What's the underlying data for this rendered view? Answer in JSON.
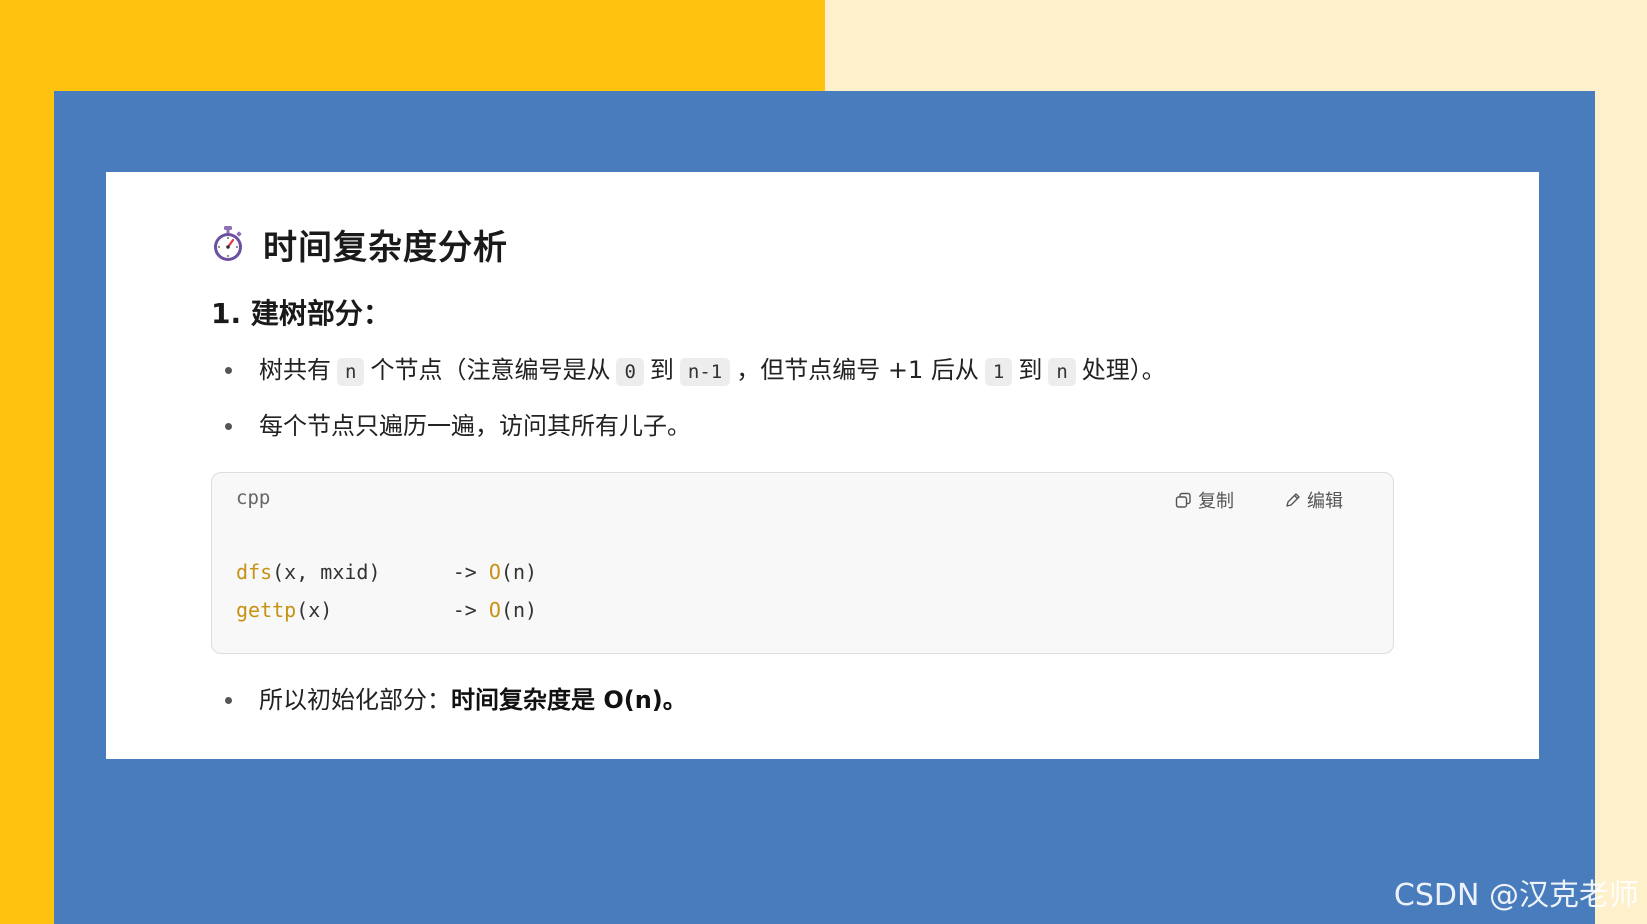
{
  "heading": {
    "icon": "stopwatch-icon",
    "title": "时间复杂度分析"
  },
  "section": {
    "title": "1. 建树部分："
  },
  "bullets": {
    "b1": {
      "t1": "树共有",
      "c1": "n",
      "t2": "个节点（注意编号是从",
      "c2": "0",
      "t3": "到",
      "c3": "n-1",
      "t4": "，但节点编号 +1 后从",
      "c4": "1",
      "t5": "到",
      "c5": "n",
      "t6": "处理）。"
    },
    "b2": {
      "text": "每个节点只遍历一遍，访问其所有儿子。"
    },
    "b3": {
      "text": "所以初始化部分：",
      "bold": "时间复杂度是 O(n)。"
    }
  },
  "codeblock": {
    "lang": "cpp",
    "copy_label": "复制",
    "edit_label": "编辑",
    "lines": [
      {
        "fn": "dfs",
        "args": "(x, mxid)",
        "arrow": "      -> ",
        "o": "O",
        "on": "(n)"
      },
      {
        "fn": "gettp",
        "args": "(x)",
        "arrow": "          -> ",
        "o": "O",
        "on": "(n)"
      }
    ]
  },
  "watermark": "CSDN @汉克老师",
  "colors": {
    "yellow": "#FFC20E",
    "cream": "#FFF0CC",
    "blue": "#487CBC",
    "code_fn": "#C69213"
  }
}
